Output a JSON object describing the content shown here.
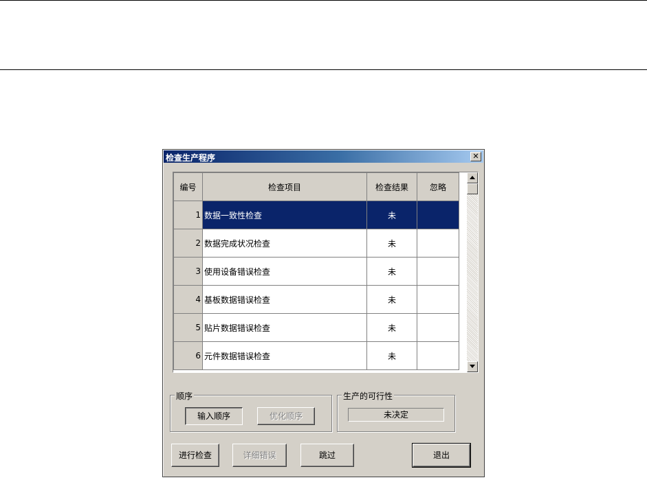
{
  "dialog": {
    "title": "检查生产程序",
    "close_glyph": "✕"
  },
  "grid": {
    "columns": [
      "编号",
      "检查项目",
      "检查结果",
      "忽略"
    ],
    "rows": [
      {
        "num": "1",
        "item": "数据一致性检查",
        "result": "未",
        "ignore": ""
      },
      {
        "num": "2",
        "item": "数据完成状况检查",
        "result": "未",
        "ignore": ""
      },
      {
        "num": "3",
        "item": "使用设备错误检查",
        "result": "未",
        "ignore": ""
      },
      {
        "num": "4",
        "item": "基板数据错误检查",
        "result": "未",
        "ignore": ""
      },
      {
        "num": "5",
        "item": "贴片数据错误检查",
        "result": "未",
        "ignore": ""
      },
      {
        "num": "6",
        "item": "元件数据错误检查",
        "result": "未",
        "ignore": ""
      }
    ],
    "selected_row": 1
  },
  "order_group": {
    "label": "顺序",
    "input_order": "输入顺序",
    "optimize_order": "优化顺序"
  },
  "feasibility_group": {
    "label": "生产的可行性",
    "status": "未决定"
  },
  "buttons": {
    "run_check": "进行检查",
    "detail_error": "详细错误",
    "skip": "跳过",
    "exit": "退出"
  },
  "colors": {
    "selection": "#0a246a",
    "dialog_face": "#d4d0c8"
  }
}
